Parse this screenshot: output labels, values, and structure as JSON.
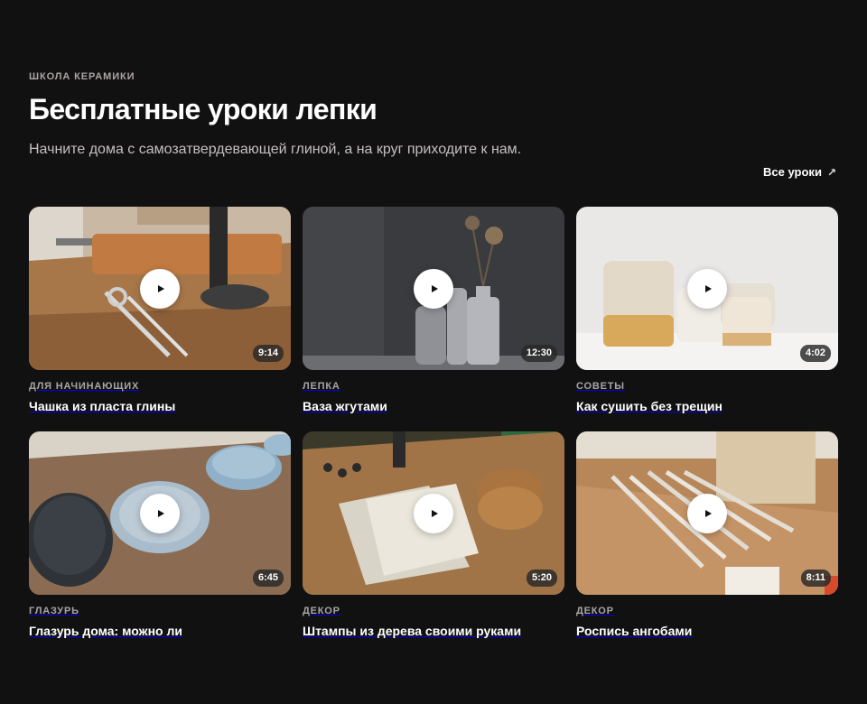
{
  "header": {
    "eyebrow": "ШКОЛА КЕРАМИКИ",
    "title": "Бесплатные уроки лепки",
    "subtitle": "Начните дома с самозатвердевающей глиной, а на круг приходите к нам.",
    "all_link_label": "Все уроки",
    "all_link_icon": "arrow-up-right-icon"
  },
  "lessons": [
    {
      "category": "ДЛЯ НАЧИНАЮЩИХ",
      "title": "Чашка из пласта глины",
      "duration": "9:14"
    },
    {
      "category": "ЛЕПКА",
      "title": "Ваза жгутами",
      "duration": "12:30"
    },
    {
      "category": "СОВЕТЫ",
      "title": "Как сушить без трещин",
      "duration": "4:02"
    },
    {
      "category": "ГЛАЗУРЬ",
      "title": "Глазурь дома: можно ли",
      "duration": "6:45"
    },
    {
      "category": "ДЕКОР",
      "title": "Штампы из дерева своими руками",
      "duration": "5:20"
    },
    {
      "category": "ДЕКОР",
      "title": "Роспись ангобами",
      "duration": "8:11"
    }
  ],
  "icons": {
    "play": "play-icon"
  }
}
